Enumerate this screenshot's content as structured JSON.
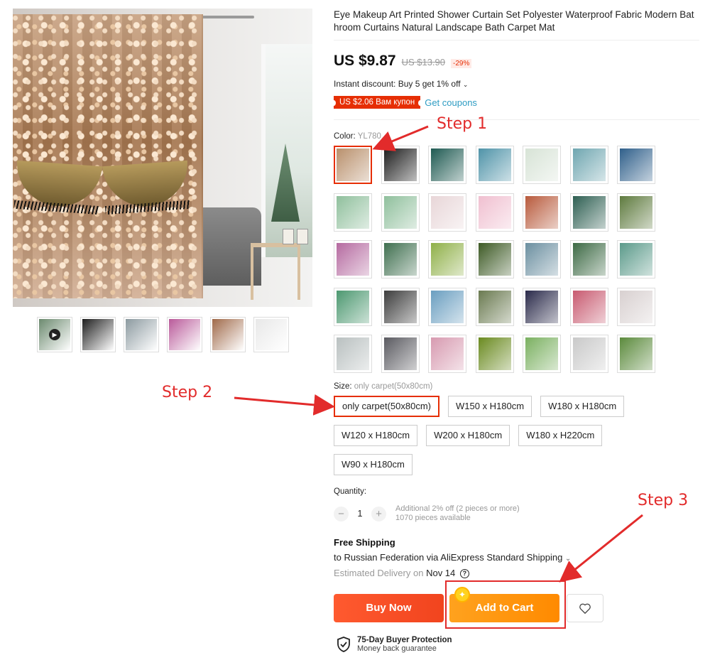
{
  "product": {
    "title": "Eye Makeup Art Printed Shower Curtain Set Polyester Waterproof Fabric Modern Bat hroom Curtains Natural Landscape Bath Carpet Mat",
    "price_current": "US $9.87",
    "price_original": "US $13.90",
    "discount": "-29%",
    "instant_discount": "Instant discount: Buy 5 get 1% off",
    "coupon_badge": "US $2.06 Вам купон",
    "get_coupons": "Get coupons"
  },
  "color": {
    "label": "Color:",
    "selected": "YL780",
    "swatch_colors": [
      "#b9906c",
      "#1d1d1d",
      "#1f5a52",
      "#4f93a8",
      "#d7e3d6",
      "#6fa6b0",
      "#2f5f8a",
      "#8fbf9c",
      "#8fbf9c",
      "#e8d6d8",
      "#f0bfd0",
      "#b85a3c",
      "#2e5f52",
      "#5e7a3e",
      "#b56aa0",
      "#3f6f4f",
      "#8fb048",
      "#3d5a25",
      "#6b8fa0",
      "#3d6a45",
      "#5b9a8a",
      "#4c9870",
      "#3c3c3c",
      "#6a9ec0",
      "#6a7a50",
      "#2a2a4a",
      "#c85a70",
      "#d8d0d0",
      "#b9c0c0",
      "#5a5a60",
      "#d79ab0",
      "#6a8a20",
      "#7ab060",
      "#c9c9c9",
      "#5b8a3c"
    ],
    "selected_index": 0
  },
  "size": {
    "label": "Size:",
    "selected": "only carpet(50x80cm)",
    "options": [
      "only carpet(50x80cm)",
      "W150 x H180cm",
      "W180 x H180cm",
      "W120 x H180cm",
      "W200 x H180cm",
      "W180 x H220cm",
      "W90 x H180cm"
    ]
  },
  "quantity": {
    "label": "Quantity:",
    "value": "1",
    "minus": "−",
    "plus": "+",
    "note_1": "Additional 2% off (2 pieces or more)",
    "note_2": "1070 pieces available"
  },
  "shipping": {
    "title": "Free Shipping",
    "destination": "to Russian Federation via AliExpress Standard Shipping",
    "estimate_prefix": "Estimated Delivery on",
    "estimate_date": "Nov 14",
    "help": "?"
  },
  "actions": {
    "buy_now": "Buy Now",
    "add_to_cart": "Add to Cart",
    "wishlist_icon": "heart-icon",
    "coin_icon": "✦"
  },
  "protection": {
    "title": "75-Day Buyer Protection",
    "subtitle": "Money back guarantee"
  },
  "annotations": {
    "step1": "Step 1",
    "step2": "Step 2",
    "step3": "Step 3",
    "color": "#e22b2b"
  },
  "gallery": {
    "thumb_colors": [
      "#6c8a6f",
      "#1e1e1e",
      "#8c9aa0",
      "#b95a9a",
      "#a06a4a",
      "#e8e8e8"
    ],
    "play_icon": "▶"
  }
}
